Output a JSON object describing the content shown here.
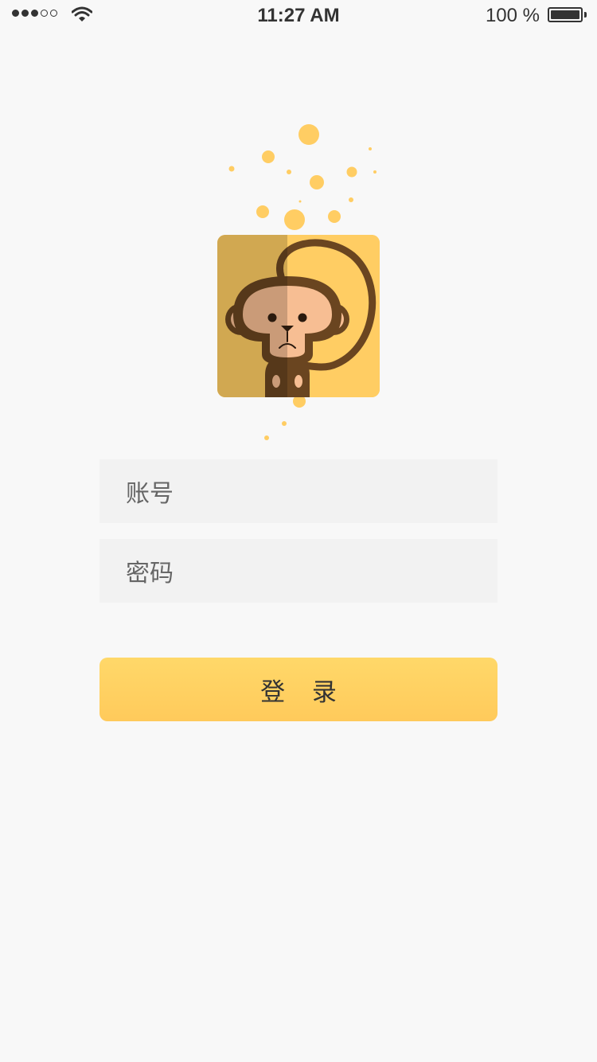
{
  "status_bar": {
    "signal_dots": [
      "filled",
      "filled",
      "filled",
      "empty",
      "empty"
    ],
    "time": "11:27 AM",
    "battery_percent": "100 %",
    "battery_level": 1.0
  },
  "login": {
    "account_placeholder": "账号",
    "password_placeholder": "密码",
    "submit_label": "登 录"
  },
  "colors": {
    "accent": "#ffcd63",
    "background": "#f8f8f8",
    "field_background": "#f2f2f2",
    "button_top": "#ffd869",
    "button_bottom": "#ffca5b",
    "monkey_dark": "#6a4520",
    "monkey_face": "#f7be93"
  },
  "icons": {
    "wifi": "wifi-icon",
    "battery": "battery-icon",
    "logo": "monkey-logo-icon"
  }
}
